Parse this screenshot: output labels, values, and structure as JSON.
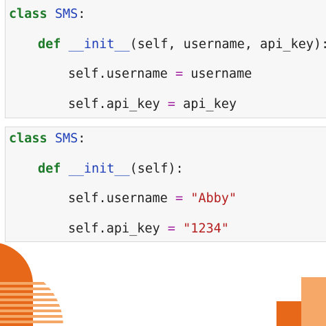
{
  "snippet_1": {
    "line_1": {
      "kw": "class",
      "name": "SMS",
      "colon": ":"
    },
    "line_2": {
      "kw": "def",
      "name": "__init__",
      "args": "(self, username, api_key):"
    },
    "line_3": {
      "lhs": "self.username",
      "op": "=",
      "rhs": "username"
    },
    "line_4": {
      "lhs": "self.api_key",
      "op": "=",
      "rhs": "api_key"
    }
  },
  "snippet_2": {
    "line_1": {
      "kw": "class",
      "name": "SMS",
      "colon": ":"
    },
    "line_2": {
      "kw": "def",
      "name": "__init__",
      "args": "(self):"
    },
    "line_3": {
      "lhs": "self.username",
      "op": "=",
      "rhs": "\"Abby\""
    },
    "line_4": {
      "lhs": "self.api_key",
      "op": "=",
      "rhs": "\"1234\""
    }
  },
  "colors": {
    "keyword": "#1c7a28",
    "class_name": "#1f3fb8",
    "operator": "#a020a0",
    "string": "#b51e1e",
    "accent_orange": "#e8681a",
    "accent_light_orange": "#f5a868"
  }
}
